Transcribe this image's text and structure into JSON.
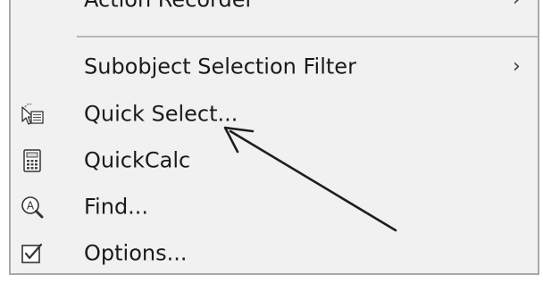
{
  "menu": {
    "items": [
      {
        "label": "Action Recorder",
        "submenu_glyph": "›"
      },
      {
        "label": "Subobject Selection Filter",
        "submenu_glyph": "›"
      },
      {
        "label": "Quick Select...",
        "icon": "quick-select-icon"
      },
      {
        "label": "QuickCalc",
        "icon": "calculator-icon"
      },
      {
        "label": "Find...",
        "icon": "find-icon"
      },
      {
        "label": "Options...",
        "icon": "options-icon"
      }
    ]
  },
  "colors": {
    "menu_background": "#f1f1f1",
    "border": "#a9a9a9",
    "text": "#1a1a1a",
    "annotation_arrow": "#1e1e1e"
  }
}
